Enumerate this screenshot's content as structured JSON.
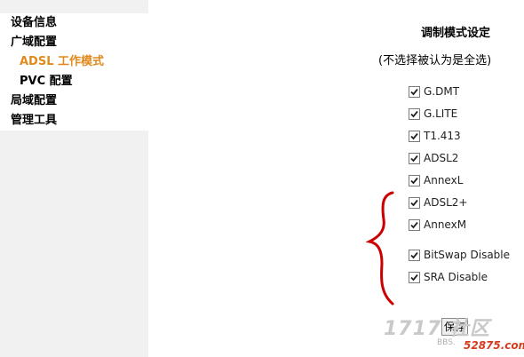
{
  "sidebar": {
    "items": [
      {
        "label": "设备信息"
      },
      {
        "label": "广域配置"
      },
      {
        "label": "ADSL 工作模式"
      },
      {
        "label": "PVC 配置"
      },
      {
        "label": "局域配置"
      },
      {
        "label": "管理工具"
      }
    ],
    "active_color": "#e08a1e"
  },
  "main": {
    "title": "调制模式设定",
    "subtitle": "(不选择被认为是全选)",
    "options": [
      {
        "label": "G.DMT",
        "checked": true
      },
      {
        "label": "G.LITE",
        "checked": true
      },
      {
        "label": "T1.413",
        "checked": true
      },
      {
        "label": "ADSL2",
        "checked": true
      },
      {
        "label": "AnnexL",
        "checked": true
      },
      {
        "label": "ADSL2+",
        "checked": true
      },
      {
        "label": "AnnexM",
        "checked": true
      },
      {
        "label": "BitSwap Disable",
        "checked": true
      },
      {
        "label": "SRA Disable",
        "checked": true
      }
    ],
    "save_label": "保存"
  },
  "watermark": {
    "text": "1717 社区",
    "bbs": "BBS.",
    "url": "52875.com"
  }
}
